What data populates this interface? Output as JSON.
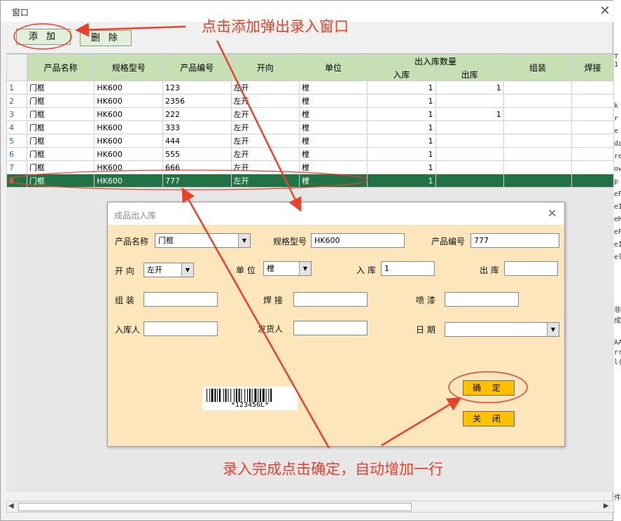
{
  "window": {
    "title": "窗口",
    "close_glyph": "✕"
  },
  "toolbar": {
    "add_label": "添 加",
    "delete_label": "删 除"
  },
  "grid": {
    "columns": [
      "产品名称",
      "规格型号",
      "产品编号",
      "开向",
      "单位",
      "出入库数量",
      "组装",
      "焊接"
    ],
    "sub_columns": [
      "入库",
      "出库"
    ],
    "rows": [
      {
        "n": "1",
        "name": "门框",
        "spec": "HK600",
        "code": "123",
        "dir": "左开",
        "unit": "樘",
        "in": "1",
        "out": "1"
      },
      {
        "n": "2",
        "name": "门框",
        "spec": "HK600",
        "code": "2356",
        "dir": "左开",
        "unit": "樘",
        "in": "1",
        "out": ""
      },
      {
        "n": "3",
        "name": "门框",
        "spec": "HK600",
        "code": "222",
        "dir": "左开",
        "unit": "樘",
        "in": "1",
        "out": "1"
      },
      {
        "n": "4",
        "name": "门框",
        "spec": "HK600",
        "code": "333",
        "dir": "左开",
        "unit": "樘",
        "in": "1",
        "out": ""
      },
      {
        "n": "5",
        "name": "门框",
        "spec": "HK600",
        "code": "444",
        "dir": "左开",
        "unit": "樘",
        "in": "1",
        "out": ""
      },
      {
        "n": "6",
        "name": "门框",
        "spec": "HK600",
        "code": "555",
        "dir": "左开",
        "unit": "樘",
        "in": "1",
        "out": ""
      },
      {
        "n": "7",
        "name": "门框",
        "spec": "HK600",
        "code": "666",
        "dir": "左开",
        "unit": "樘",
        "in": "1",
        "out": ""
      },
      {
        "n": "8",
        "name": "门框",
        "spec": "HK600",
        "code": "777",
        "dir": "左开",
        "unit": "樘",
        "in": "1",
        "out": ""
      }
    ],
    "selected_row": "8"
  },
  "side_text": [
    "k",
    "r",
    "e",
    "da",
    "re",
    "ow",
    "p",
    "eF",
    "eI",
    "eM",
    "eF",
    "eI",
    "el"
  ],
  "side_text_low": [
    "AA",
    "rr",
    "l("
  ],
  "side_text_mid": [
    "非成"
  ],
  "side_text_top": [
    "T",
    "1"
  ],
  "side_text_bottom": [
    "件"
  ],
  "dialog": {
    "title": "成品出入库",
    "close_glyph": "✕",
    "labels": {
      "product_name": "产品名称",
      "spec": "规格型号",
      "product_code": "产品编号",
      "direction": "开 向",
      "unit": "单 位",
      "in": "入 库",
      "out": "出 库",
      "assembly": "组 装",
      "welding": "焊 接",
      "painting": "喷 漆",
      "receiver": "入库人",
      "shipper": "发货人",
      "date": "日 期"
    },
    "values": {
      "product_name": "门框",
      "spec": "HK600",
      "product_code": "777",
      "direction": "左开",
      "unit": "樘",
      "in": "1",
      "out": "",
      "assembly": "",
      "welding": "",
      "painting": "",
      "receiver": "",
      "shipper": "",
      "date": ""
    },
    "barcode_text": "*123456L*",
    "confirm_label": "确 定",
    "close_label": "关 闭"
  },
  "annotations": {
    "top": "点击添加弹出录入窗口",
    "bottom": "录入完成点击确定，自动增加一行"
  },
  "colors": {
    "annotation": "#e8412c",
    "header": "#c6e0b4",
    "selected_row": "#217346",
    "dialog_bg": "#fde6bb",
    "button_yellow": "#ffc000"
  }
}
